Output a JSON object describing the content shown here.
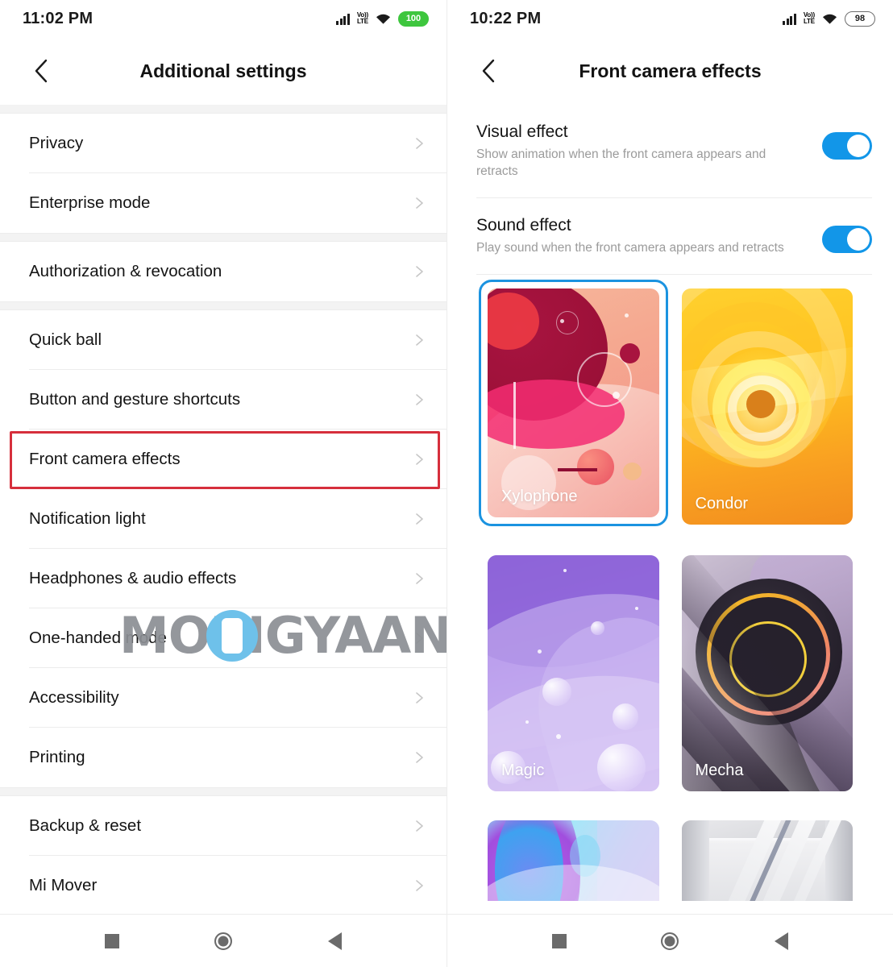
{
  "left_phone": {
    "status_bar": {
      "time": "11:02 PM",
      "signal_icon": "signal-bars-icon",
      "volte_icon_top": "Vo))",
      "volte_icon_bottom": "LTE",
      "wifi_icon": "wifi-icon",
      "battery_level": "100",
      "battery_color": "#3ec63e"
    },
    "title": "Additional settings",
    "back_icon": "back-chevron-icon",
    "groups": [
      {
        "items": [
          {
            "label": "Privacy",
            "chevron": "chevron-right-icon"
          },
          {
            "label": "Enterprise mode",
            "chevron": "chevron-right-icon"
          }
        ]
      },
      {
        "items": [
          {
            "label": "Authorization & revocation",
            "chevron": "chevron-right-icon"
          }
        ]
      },
      {
        "items": [
          {
            "label": "Quick ball",
            "chevron": "chevron-right-icon"
          },
          {
            "label": "Button and gesture shortcuts",
            "chevron": "chevron-right-icon"
          },
          {
            "label": "Front camera effects",
            "chevron": "chevron-right-icon",
            "highlighted": true
          },
          {
            "label": "Notification light",
            "chevron": "chevron-right-icon"
          },
          {
            "label": "Headphones & audio effects",
            "chevron": "chevron-right-icon"
          },
          {
            "label": "One-handed mode",
            "chevron": "chevron-right-icon"
          },
          {
            "label": "Accessibility",
            "chevron": "chevron-right-icon"
          },
          {
            "label": "Printing",
            "chevron": "chevron-right-icon"
          }
        ]
      },
      {
        "items": [
          {
            "label": "Backup & reset",
            "chevron": "chevron-right-icon"
          },
          {
            "label": "Mi Mover",
            "chevron": "chevron-right-icon"
          }
        ]
      }
    ],
    "highlight_color": "#d62f3c"
  },
  "right_phone": {
    "status_bar": {
      "time": "10:22 PM",
      "signal_icon": "signal-bars-icon",
      "volte_icon_top": "Vo))",
      "volte_icon_bottom": "LTE",
      "wifi_icon": "wifi-icon",
      "battery_level": "98",
      "battery_color": "#ffffff"
    },
    "title": "Front camera effects",
    "back_icon": "back-chevron-icon",
    "toggles": [
      {
        "title": "Visual effect",
        "subtitle": "Show animation when the front camera appears and retracts",
        "state": "on"
      },
      {
        "title": "Sound effect",
        "subtitle": "Play sound when the front camera appears and retracts",
        "state": "on"
      }
    ],
    "toggle_on_color": "#1296e8",
    "selected_border_color": "#1b93e0",
    "effects": [
      {
        "name": "Xylophone",
        "selected": true,
        "theme": "xylophone"
      },
      {
        "name": "Condor",
        "selected": false,
        "theme": "condor"
      },
      {
        "name": "Magic",
        "selected": false,
        "theme": "magic"
      },
      {
        "name": "Mecha",
        "selected": false,
        "theme": "mecha"
      },
      {
        "name": "",
        "selected": false,
        "theme": "tech"
      },
      {
        "name": "",
        "selected": false,
        "theme": "steel"
      }
    ]
  },
  "watermark": {
    "text": "MOBIGYAAN",
    "badge_icon": "phone-in-circle-icon",
    "color": "#8c8f94",
    "badge_color": "#6ec1ea"
  },
  "nav_bar": {
    "recents_icon": "square-recents-icon",
    "home_icon": "circle-home-icon",
    "back_icon": "triangle-back-icon"
  }
}
